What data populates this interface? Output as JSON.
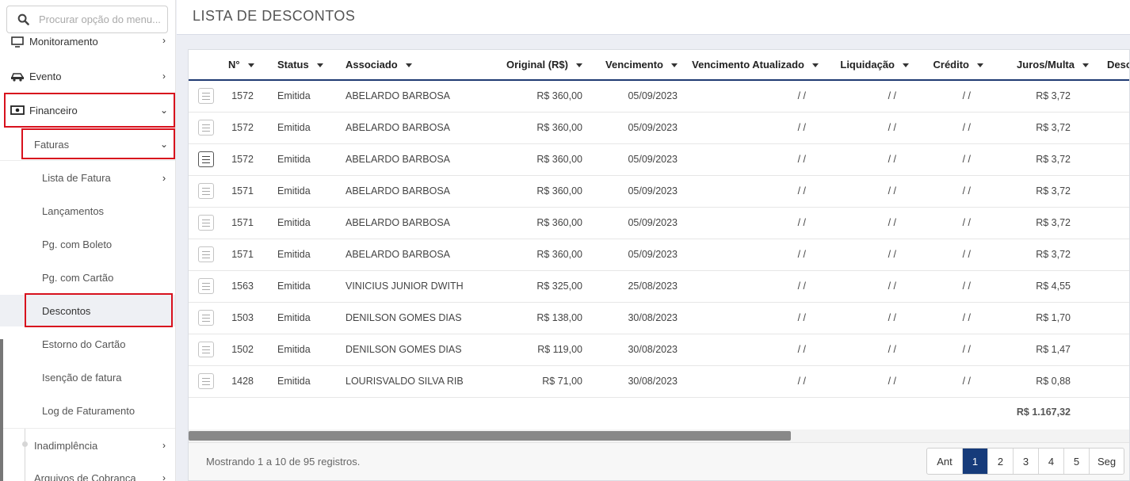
{
  "search": {
    "placeholder": "Procurar opção do menu..."
  },
  "sidebar": {
    "monitoramento": "Monitoramento",
    "evento": "Evento",
    "financeiro": "Financeiro",
    "faturas": "Faturas",
    "sub_items": [
      "Lista de Fatura",
      "Lançamentos",
      "Pg. com Boleto",
      "Pg. com Cartão",
      "Descontos",
      "Estorno do Cartão",
      "Isenção de fatura",
      "Log de Faturamento"
    ],
    "inadimplencia": "Inadimplência",
    "arquivos": "Arquivos de Cobrança"
  },
  "page": {
    "title": "LISTA DE DESCONTOS"
  },
  "table": {
    "headers": [
      "N°",
      "Status",
      "Associado",
      "Original (R$)",
      "Vencimento",
      "Vencimento Atualizado",
      "Liquidação",
      "Crédito",
      "Juros/Multa",
      "Desco"
    ],
    "rows": [
      [
        "1572",
        "Emitida",
        "ABELARDO BARBOSA",
        "R$ 360,00",
        "05/09/2023",
        "/ /",
        "/ /",
        "/ /",
        "R$ 3,72"
      ],
      [
        "1572",
        "Emitida",
        "ABELARDO BARBOSA",
        "R$ 360,00",
        "05/09/2023",
        "/ /",
        "/ /",
        "/ /",
        "R$ 3,72"
      ],
      [
        "1572",
        "Emitida",
        "ABELARDO BARBOSA",
        "R$ 360,00",
        "05/09/2023",
        "/ /",
        "/ /",
        "/ /",
        "R$ 3,72"
      ],
      [
        "1571",
        "Emitida",
        "ABELARDO BARBOSA",
        "R$ 360,00",
        "05/09/2023",
        "/ /",
        "/ /",
        "/ /",
        "R$ 3,72"
      ],
      [
        "1571",
        "Emitida",
        "ABELARDO BARBOSA",
        "R$ 360,00",
        "05/09/2023",
        "/ /",
        "/ /",
        "/ /",
        "R$ 3,72"
      ],
      [
        "1571",
        "Emitida",
        "ABELARDO BARBOSA",
        "R$ 360,00",
        "05/09/2023",
        "/ /",
        "/ /",
        "/ /",
        "R$ 3,72"
      ],
      [
        "1563",
        "Emitida",
        "VINICIUS JUNIOR DWITH",
        "R$ 325,00",
        "25/08/2023",
        "/ /",
        "/ /",
        "/ /",
        "R$ 4,55"
      ],
      [
        "1503",
        "Emitida",
        "DENILSON GOMES DIAS",
        "R$ 138,00",
        "30/08/2023",
        "/ /",
        "/ /",
        "/ /",
        "R$ 1,70"
      ],
      [
        "1502",
        "Emitida",
        "DENILSON GOMES DIAS",
        "R$ 119,00",
        "30/08/2023",
        "/ /",
        "/ /",
        "/ /",
        "R$ 1,47"
      ],
      [
        "1428",
        "Emitida",
        "LOURISVALDO SILVA RIBEIRO",
        "R$ 71,00",
        "30/08/2023",
        "/ /",
        "/ /",
        "/ /",
        "R$ 0,88"
      ]
    ],
    "total": "R$ 1.167,32"
  },
  "footer": {
    "showing": "Mostrando 1 a 10 de 95 registros."
  },
  "pagination": {
    "prev": "Ant",
    "pages": [
      "1",
      "2",
      "3",
      "4",
      "5"
    ],
    "next": "Seg",
    "current": "1"
  },
  "colors": {
    "accent": "#163b7a",
    "highlight": "#d8111d"
  }
}
